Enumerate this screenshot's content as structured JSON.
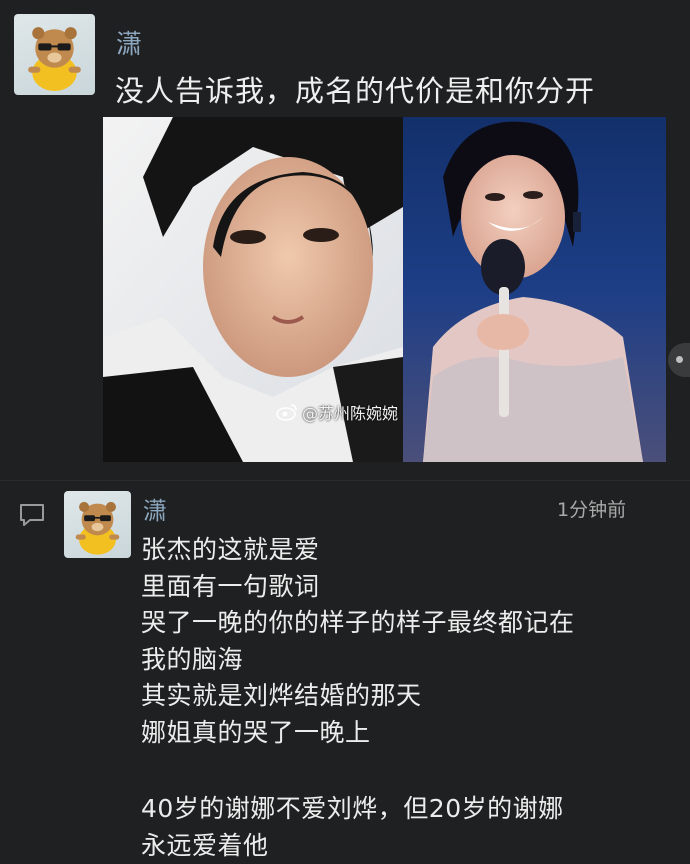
{
  "post": {
    "author": "潇",
    "text": "没人告诉我，成名的代价是和你分开",
    "image_watermark": "@苏州陈婉婉",
    "avatar_icon": "sunglasses-bear-avatar-icon"
  },
  "comment": {
    "author": "潇",
    "time": "1分钟前",
    "icon": "comment-bubble-icon",
    "lines": [
      "张杰的这就是爱",
      "里面有一句歌词",
      "哭了一晚的你的样子的样子最终都记在",
      "我的脑海",
      "其实就是刘烨结婚的那天",
      "娜姐真的哭了一晚上",
      "",
      "40岁的谢娜不爱刘烨，但20岁的谢娜",
      "永远爱着他"
    ]
  },
  "colors": {
    "background": "#1f2021",
    "name": "#8da7bf",
    "text": "#efefef",
    "time": "#a9a9a9"
  }
}
